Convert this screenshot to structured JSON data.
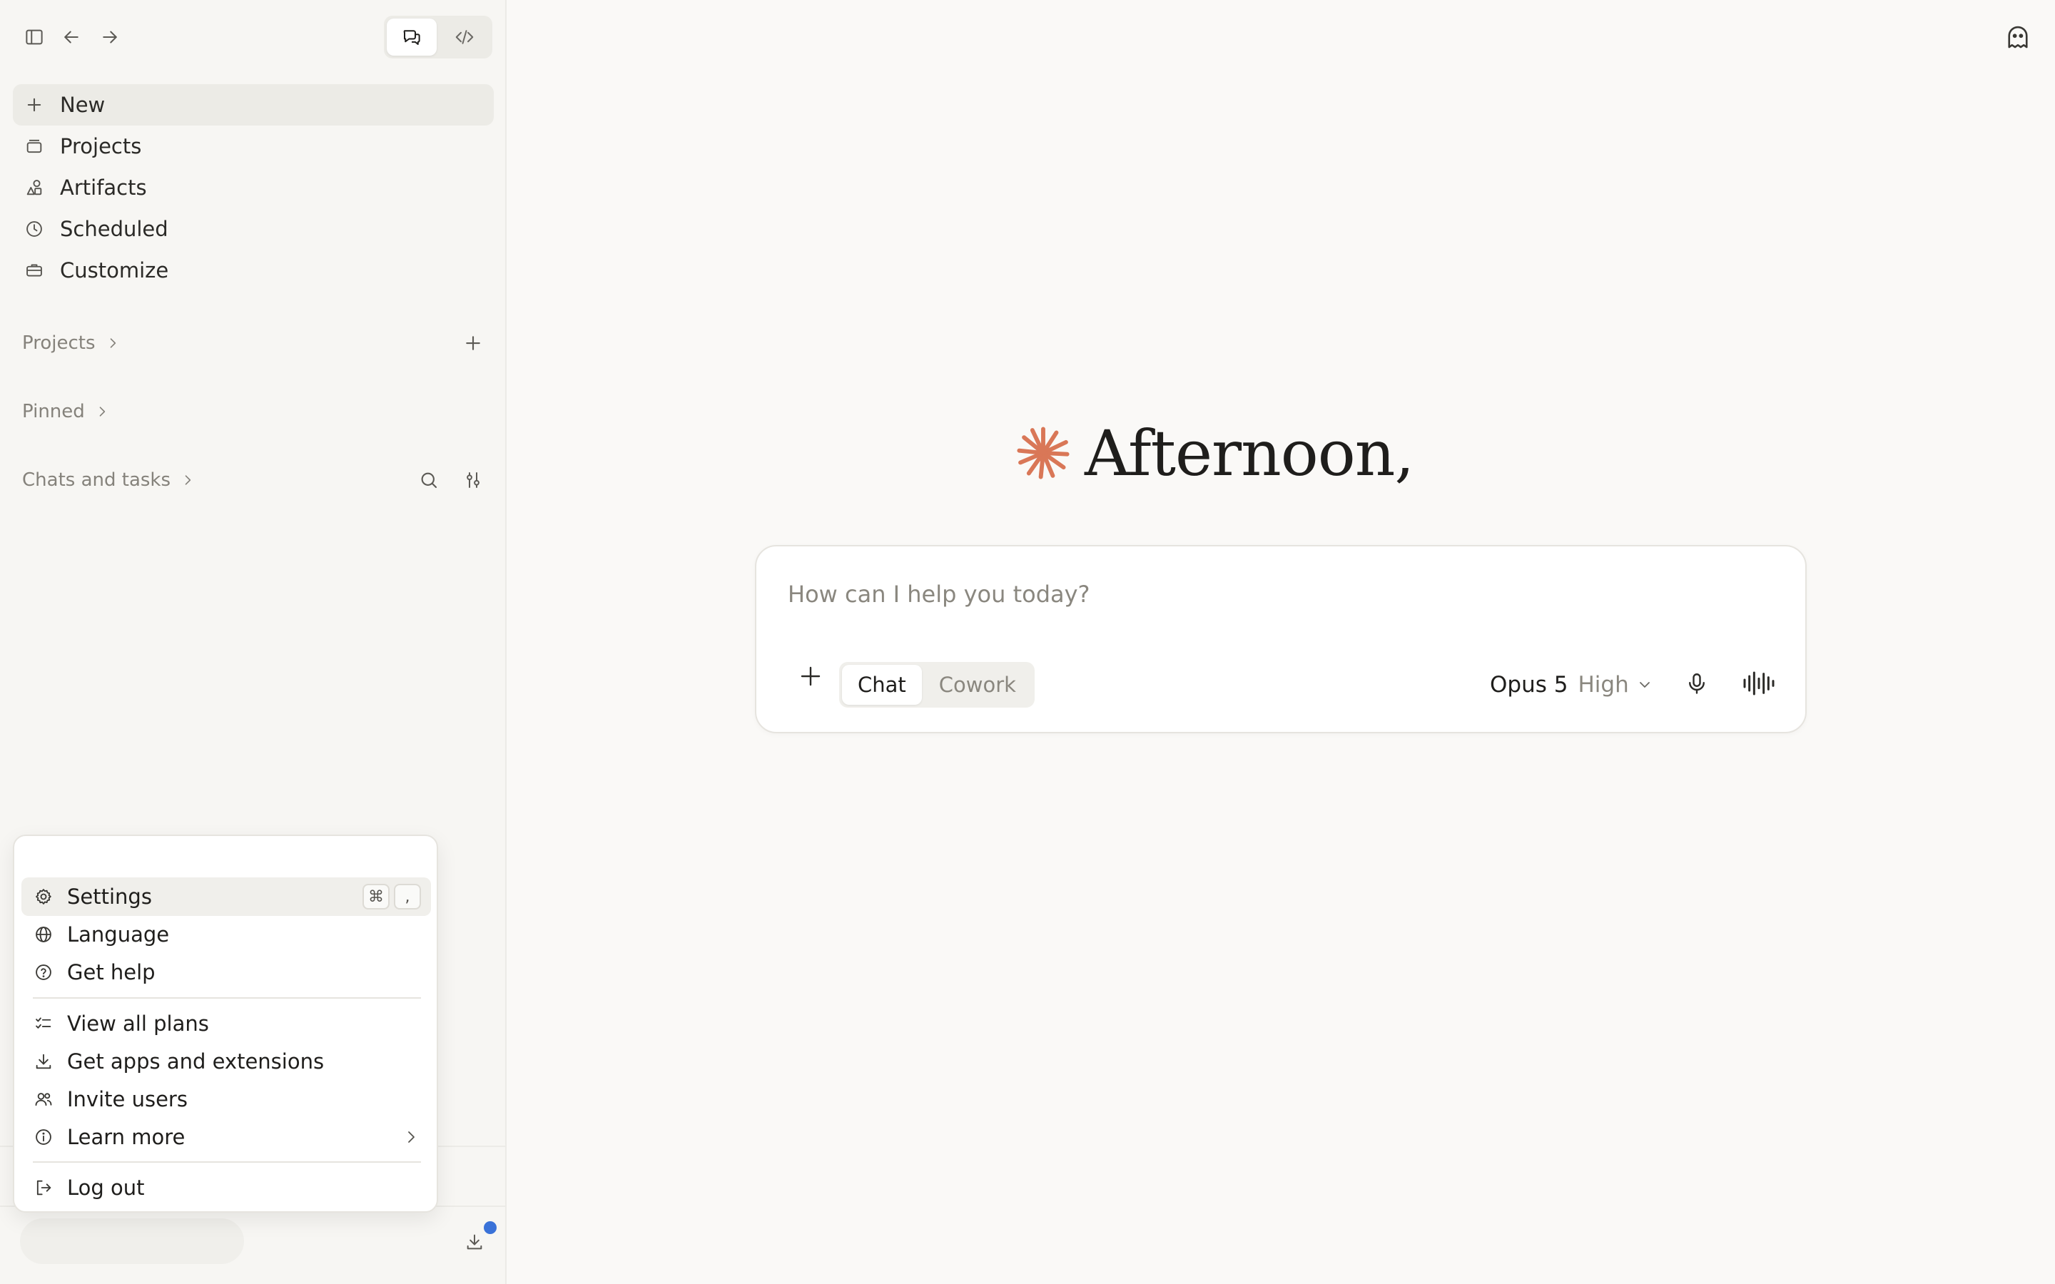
{
  "sidebar": {
    "nav": [
      {
        "label": "New",
        "icon": "plus-icon"
      },
      {
        "label": "Projects",
        "icon": "folder-icon"
      },
      {
        "label": "Artifacts",
        "icon": "shapes-icon"
      },
      {
        "label": "Scheduled",
        "icon": "clock-icon"
      },
      {
        "label": "Customize",
        "icon": "briefcase-icon"
      }
    ],
    "sections": {
      "projects": "Projects",
      "pinned": "Pinned",
      "chats": "Chats and tasks"
    }
  },
  "menu": {
    "settings": "Settings",
    "settings_shortcut": [
      "⌘",
      ","
    ],
    "language": "Language",
    "get_help": "Get help",
    "view_all_plans": "View all plans",
    "get_apps": "Get apps and extensions",
    "invite_users": "Invite users",
    "learn_more": "Learn more",
    "log_out": "Log out"
  },
  "main": {
    "greeting": "Afternoon,",
    "composer": {
      "placeholder": "How can I help you today?",
      "modes": [
        "Chat",
        "Cowork"
      ],
      "active_mode": "Chat",
      "model_name": "Opus 5",
      "effort": "High"
    }
  },
  "colors": {
    "brand_accent": "#d97757",
    "notification": "#3a72d8",
    "background": "#faf9f7"
  }
}
